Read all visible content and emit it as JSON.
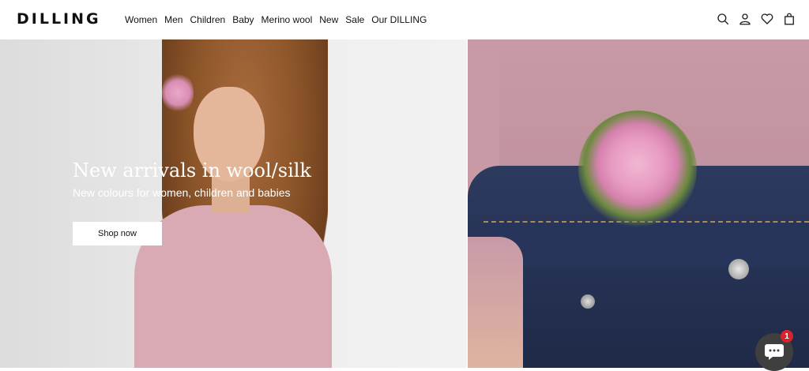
{
  "brand": {
    "logo": "DILLING"
  },
  "nav": {
    "items": [
      "Women",
      "Men",
      "Children",
      "Baby",
      "Merino wool",
      "New",
      "Sale",
      "Our DILLING"
    ]
  },
  "header_icons": [
    "search-icon",
    "account-icon",
    "heart-icon",
    "bag-icon"
  ],
  "hero": {
    "title": "New arrivals in wool/silk",
    "subtitle": "New colours for women, children and babies",
    "cta": "Shop now"
  },
  "chat": {
    "badge": "1"
  },
  "colors": {
    "text": "#111111",
    "cta_bg": "#ffffff",
    "badge": "#d9232d"
  }
}
